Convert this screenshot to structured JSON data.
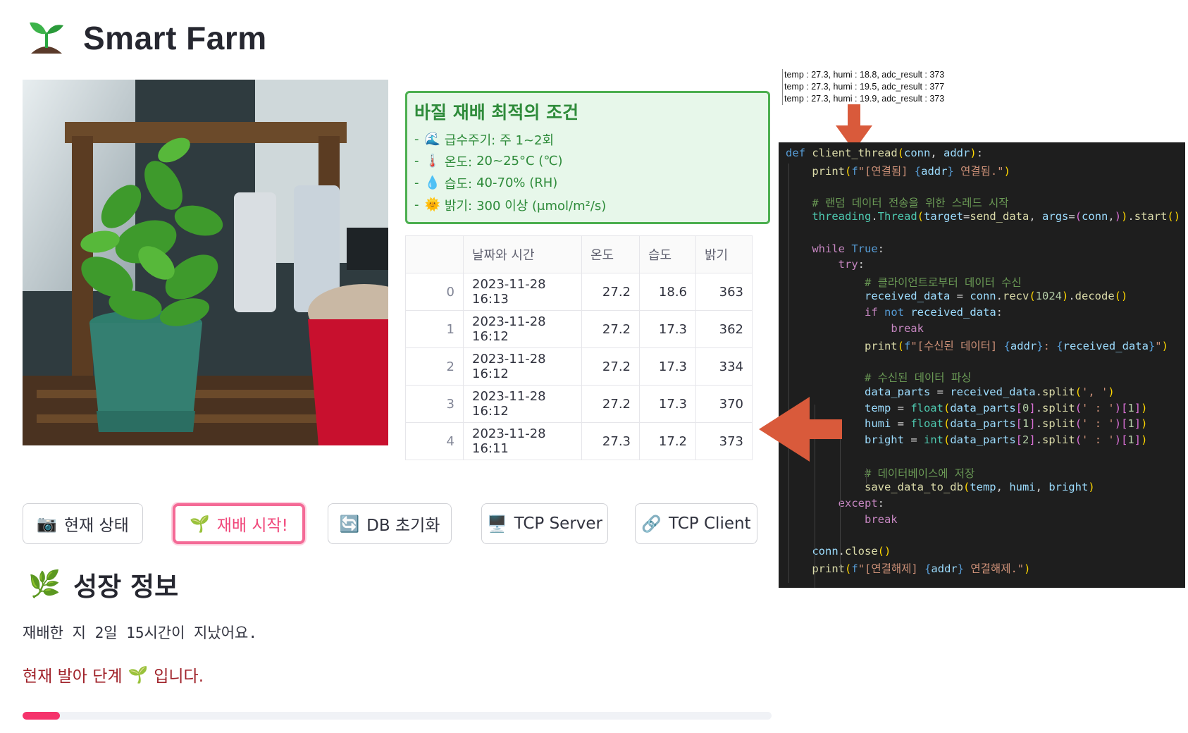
{
  "header": {
    "title": "Smart Farm",
    "logo_icon": "seedling-icon"
  },
  "conditions": {
    "title": "바질 재배 최적의 조건",
    "items": [
      {
        "icon": "wave-icon",
        "label": "급수주기:",
        "value": "주 1~2회"
      },
      {
        "icon": "thermometer-icon",
        "label": "온도:",
        "value": "20~25°C (℃)"
      },
      {
        "icon": "droplet-icon",
        "label": "습도:",
        "value": "40-70% (RH)"
      },
      {
        "icon": "sun-icon",
        "label": "밝기:",
        "value": "300 이상 (μmol/m²/s)"
      }
    ]
  },
  "table": {
    "headers": [
      "",
      "날짜와 시간",
      "온도",
      "습도",
      "밝기"
    ],
    "rows": [
      [
        "0",
        "2023-11-28 16:13",
        "27.2",
        "18.6",
        "363"
      ],
      [
        "1",
        "2023-11-28 16:12",
        "27.2",
        "17.3",
        "362"
      ],
      [
        "2",
        "2023-11-28 16:12",
        "27.2",
        "17.3",
        "334"
      ],
      [
        "3",
        "2023-11-28 16:12",
        "27.2",
        "17.3",
        "370"
      ],
      [
        "4",
        "2023-11-28 16:11",
        "27.3",
        "17.2",
        "373"
      ]
    ]
  },
  "buttons": {
    "status": {
      "icon": "camera-icon",
      "label": "현재 상태"
    },
    "start": {
      "icon": "seedling-icon",
      "label": "재배 시작!"
    },
    "db_reset": {
      "icon": "refresh-icon",
      "label": "DB 초기화"
    },
    "tcp_server": {
      "icon": "monitor-icon",
      "label": "TCP Server"
    },
    "tcp_client": {
      "icon": "link-icon",
      "label": "TCP Client"
    }
  },
  "growth": {
    "title": "성장 정보",
    "title_icon": "herb-icon",
    "elapsed_text": "재배한 지 2일 15시간이 지났어요.",
    "stage_prefix": "현재 발아 단계",
    "stage_suffix": "입니다.",
    "progress": 0.05,
    "progress_color": "#f5336b"
  },
  "log_lines": [
    "temp : 27.3, humi : 18.8, adc_result : 373",
    "temp : 27.3, humi : 19.5, adc_result : 377",
    "temp : 27.3, humi : 19.9, adc_result : 373"
  ],
  "colors": {
    "accent": "#f0477a",
    "condition_green": "#2e8b3a",
    "arrow": "#d95a3b",
    "stage_text": "#a0222a"
  }
}
